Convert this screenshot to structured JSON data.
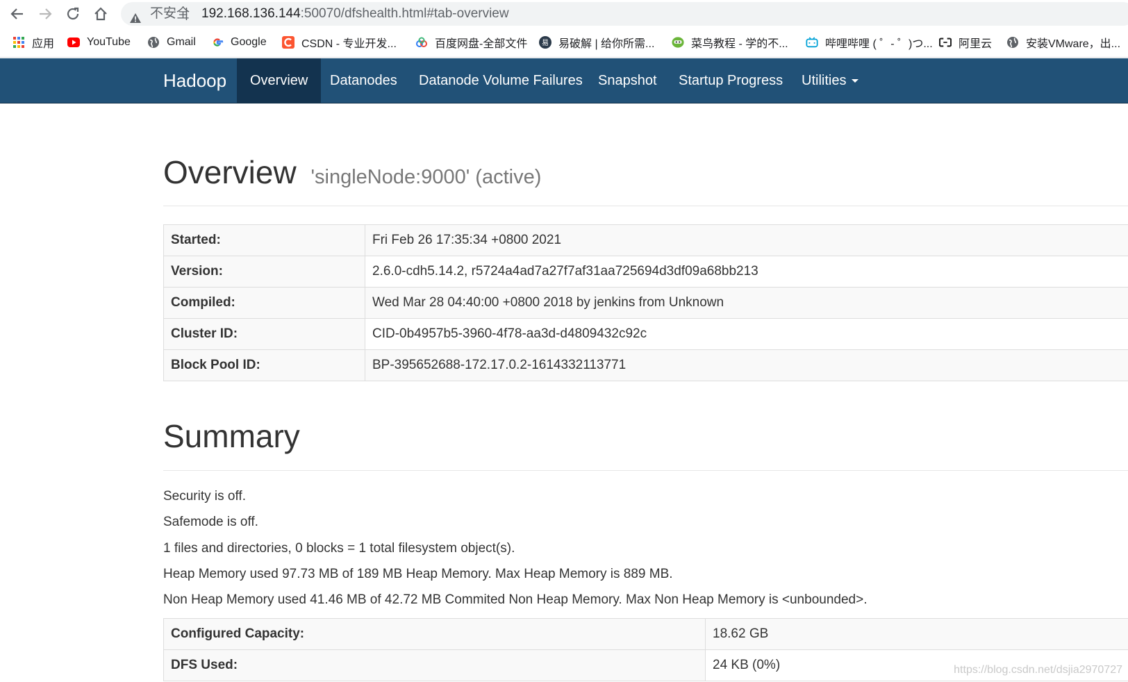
{
  "browser": {
    "security_label": "不安全",
    "separator": "|",
    "url_host": "192.168.136.144",
    "url_path": ":50070/dfshealth.html#tab-overview",
    "bookmarks": [
      {
        "label": "应用",
        "icon": "apps-grid-icon"
      },
      {
        "label": "YouTube",
        "icon": "youtube-icon"
      },
      {
        "label": "Gmail",
        "icon": "globe-icon"
      },
      {
        "label": "Google",
        "icon": "google-icon"
      },
      {
        "label": "CSDN - 专业开发...",
        "icon": "csdn-icon"
      },
      {
        "label": "百度网盘-全部文件",
        "icon": "baidu-pan-icon"
      },
      {
        "label": "易破解 | 给你所需...",
        "icon": "yipojie-icon"
      },
      {
        "label": "菜鸟教程 - 学的不...",
        "icon": "runoob-icon"
      },
      {
        "label": "哔哩哔哩 ( ゜- ゜)つ...",
        "icon": "bilibili-icon"
      },
      {
        "label": "阿里云",
        "icon": "aliyun-icon"
      },
      {
        "label": "安装VMware，出...",
        "icon": "globe-icon"
      }
    ]
  },
  "navbar": {
    "brand": "Hadoop",
    "items": [
      {
        "label": "Overview",
        "active": true
      },
      {
        "label": "Datanodes"
      },
      {
        "label": "Datanode Volume Failures"
      },
      {
        "label": "Snapshot"
      },
      {
        "label": "Startup Progress"
      },
      {
        "label": "Utilities",
        "dropdown": true
      }
    ]
  },
  "overview": {
    "title": "Overview",
    "subtitle": "'singleNode:9000' (active)",
    "rows": [
      {
        "key": "Started:",
        "value": "Fri Feb 26 17:35:34 +0800 2021"
      },
      {
        "key": "Version:",
        "value": "2.6.0-cdh5.14.2, r5724a4ad7a27f7af31aa725694d3df09a68bb213"
      },
      {
        "key": "Compiled:",
        "value": "Wed Mar 28 04:40:00 +0800 2018 by jenkins from Unknown"
      },
      {
        "key": "Cluster ID:",
        "value": "CID-0b4957b5-3960-4f78-aa3d-d4809432c92c"
      },
      {
        "key": "Block Pool ID:",
        "value": "BP-395652688-172.17.0.2-1614332113771"
      }
    ]
  },
  "summary": {
    "title": "Summary",
    "lines": [
      "Security is off.",
      "Safemode is off.",
      "1 files and directories, 0 blocks = 1 total filesystem object(s).",
      "Heap Memory used 97.73 MB of 189 MB Heap Memory. Max Heap Memory is 889 MB.",
      "Non Heap Memory used 41.46 MB of 42.72 MB Commited Non Heap Memory. Max Non Heap Memory is <unbounded>."
    ],
    "rows": [
      {
        "key": "Configured Capacity:",
        "value": "18.62 GB"
      },
      {
        "key": "DFS Used:",
        "value": "24 KB (0%)"
      }
    ]
  },
  "watermark": "https://blog.csdn.net/dsjia2970727"
}
